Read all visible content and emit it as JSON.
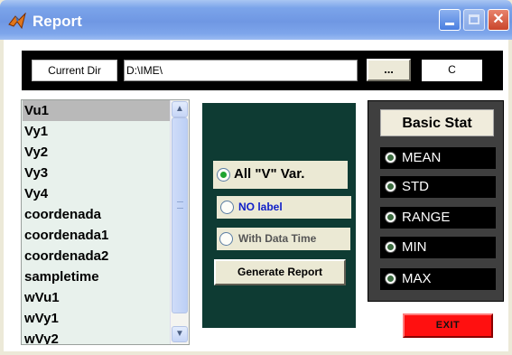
{
  "window": {
    "title": "Report",
    "app_icon": "matlab-icon"
  },
  "top_bar": {
    "current_dir_label": "Current Dir",
    "path_value": "D:\\IME\\",
    "browse_label": "...",
    "drive_value": "C"
  },
  "variables": {
    "selected_index": 0,
    "items": [
      "Vu1",
      "Vy1",
      "Vy2",
      "Vy3",
      "Vy4",
      "coordenada",
      "coordenada1",
      "coordenada2",
      "sampletime",
      "wVu1",
      "wVy1",
      "wVy2"
    ]
  },
  "options": {
    "all_v_label": "All \"V\" Var.",
    "no_label_label": "NO label",
    "with_time_label": "With Data Time",
    "selected": "all_v",
    "no_label_color": "#1020c8",
    "with_time_color": "#555555"
  },
  "generate_label": "Generate Report",
  "stats": {
    "header": "Basic Stat",
    "items": [
      "MEAN",
      "STD",
      "RANGE",
      "MIN",
      "MAX"
    ]
  },
  "exit_label": "EXIT",
  "colors": {
    "middle_panel": "#0e3b33",
    "stat_panel": "#3f3f3f",
    "exit": "#ff1010",
    "selected_radio": "#1fa430"
  }
}
